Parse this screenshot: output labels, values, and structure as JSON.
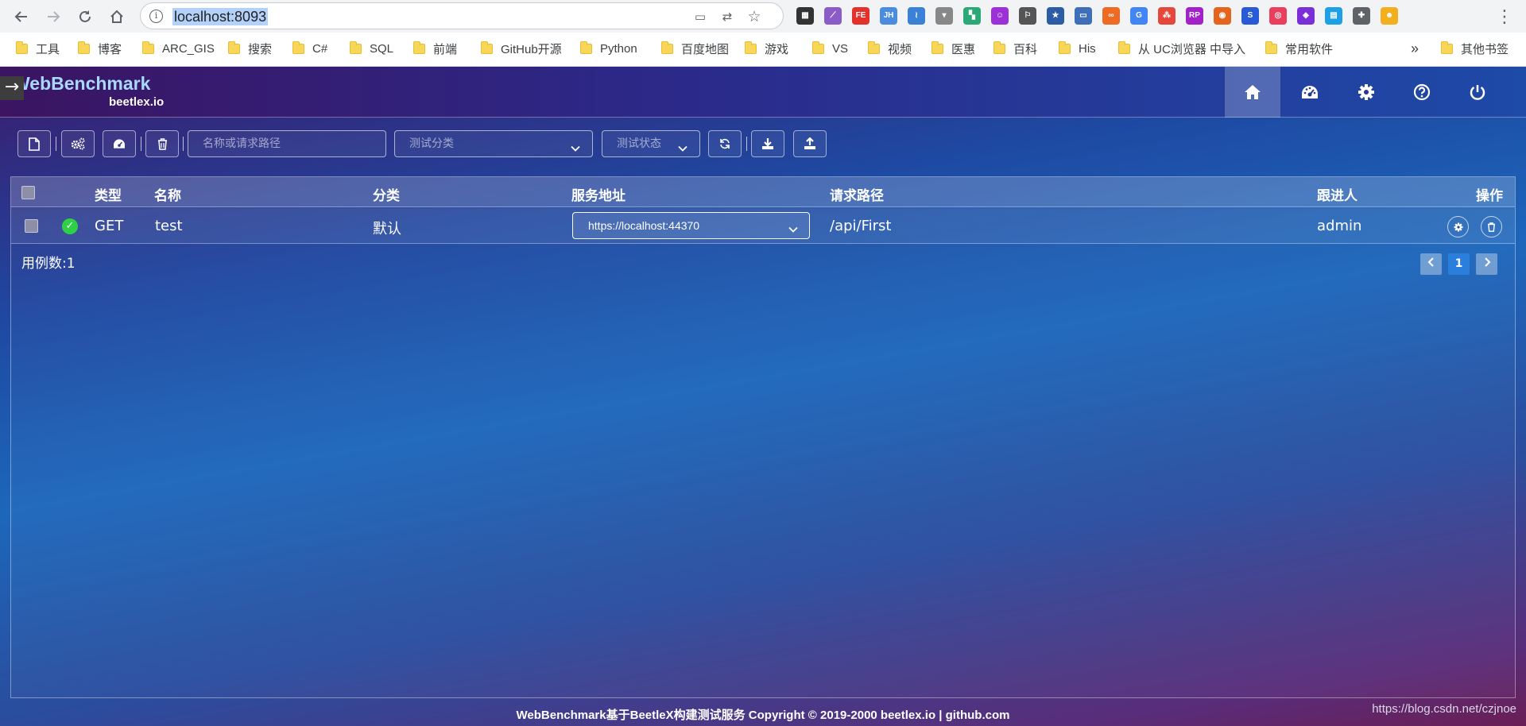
{
  "browser": {
    "url": "localhost:8093",
    "extensions": [
      {
        "icon": "qr-code-icon",
        "text": "▦",
        "color": "#333333"
      },
      {
        "icon": "quill-pen-icon",
        "text": "⟋",
        "color": "#8b5cc7"
      },
      {
        "icon": "fe-extension-icon",
        "text": "FE",
        "color": "#e4322b"
      },
      {
        "icon": "jh-extension-icon",
        "text": "JH",
        "color": "#4a8ce0"
      },
      {
        "icon": "wave-extension-icon",
        "text": "≀",
        "color": "#3b82d6"
      },
      {
        "icon": "dropdown-extension-icon",
        "text": "▾",
        "color": "#888888"
      },
      {
        "icon": "apps-extension-icon",
        "text": "▚",
        "color": "#2aa876"
      },
      {
        "icon": "smile-extension-icon",
        "text": "☺",
        "color": "#9b31d6"
      },
      {
        "icon": "bookmark-extension-icon",
        "text": "⚐",
        "color": "#555555"
      },
      {
        "icon": "star-box-extension-icon",
        "text": "★",
        "color": "#2d5ba6"
      },
      {
        "icon": "window-extension-icon",
        "text": "▭",
        "color": "#3f6fb8"
      },
      {
        "icon": "infinity-extension-icon",
        "text": "∞",
        "color": "#ef6a22"
      },
      {
        "icon": "translate-extension-icon",
        "text": "G",
        "color": "#4285f4"
      },
      {
        "icon": "network-extension-icon",
        "text": "⁂",
        "color": "#e6473b"
      },
      {
        "icon": "rp-extension-icon",
        "text": "RP",
        "color": "#a321c9"
      },
      {
        "icon": "firefox-extension-icon",
        "text": "◉",
        "color": "#e5641d"
      },
      {
        "icon": "s-extension-icon",
        "text": "S",
        "color": "#2a5bd7"
      },
      {
        "icon": "spiral-extension-icon",
        "text": "◎",
        "color": "#e93e5c"
      },
      {
        "icon": "cube-extension-icon",
        "text": "◈",
        "color": "#7b2fd9"
      },
      {
        "icon": "panel-extension-icon",
        "text": "▤",
        "color": "#1ea0e6"
      },
      {
        "icon": "puzzle-icon",
        "text": "✚",
        "color": "#5f6368"
      },
      {
        "icon": "profile-avatar-icon",
        "text": "☻",
        "color": "#f2b01e"
      }
    ],
    "bookmarks": [
      "工具",
      "博客",
      "ARC_GIS",
      "搜索",
      "C#",
      "SQL",
      "前端",
      "GitHub开源",
      "Python",
      "百度地图",
      "游戏",
      "VS",
      "视频",
      "医惠",
      "百科",
      "His",
      "从 UC浏览器 中导入",
      "常用软件"
    ],
    "more": "»",
    "other_bookmarks": "其他书签"
  },
  "app": {
    "brand": "WebBenchmark",
    "brand_sub": "beetlex.io",
    "nav": [
      "home",
      "dashboard",
      "settings",
      "help",
      "power"
    ]
  },
  "toolbar": {
    "search_placeholder": "名称或请求路径",
    "category_placeholder": "测试分类",
    "status_placeholder": "测试状态"
  },
  "table": {
    "headers": {
      "type": "类型",
      "name": "名称",
      "category": "分类",
      "server": "服务地址",
      "path": "请求路径",
      "owner": "跟进人",
      "actions": "操作"
    },
    "rows": [
      {
        "status": "ok",
        "type": "GET",
        "name": "test",
        "category": "默认",
        "server": "https://localhost:44370",
        "path": "/api/First",
        "owner": "admin"
      }
    ],
    "count_label": "用例数:1",
    "pagination": {
      "current": "1"
    }
  },
  "footer": "WebBenchmark基于BeetleX构建测试服务 Copyright © 2019-2000 beetlex.io | github.com",
  "watermark": "https://blog.csdn.net/czjnoe"
}
